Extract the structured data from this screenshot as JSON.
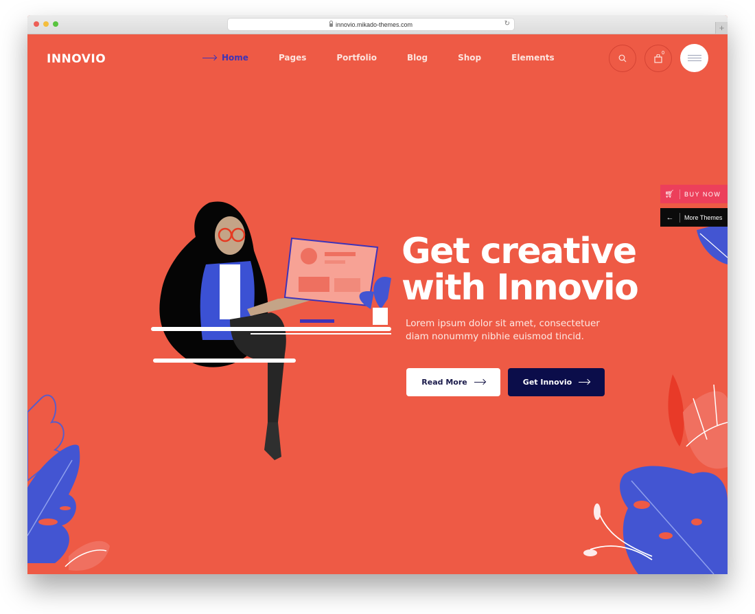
{
  "browser": {
    "url": "innovio.mikado-themes.com",
    "new_tab_label": "+"
  },
  "header": {
    "logo": "INNOVIO",
    "nav": [
      {
        "label": "Home",
        "active": true
      },
      {
        "label": "Pages",
        "active": false
      },
      {
        "label": "Portfolio",
        "active": false
      },
      {
        "label": "Blog",
        "active": false
      },
      {
        "label": "Shop",
        "active": false
      },
      {
        "label": "Elements",
        "active": false
      }
    ],
    "cart_count": "0"
  },
  "side_widgets": {
    "buy_now": "BUY NOW",
    "more_themes": "More Themes"
  },
  "hero": {
    "title_line1": "Get creative",
    "title_line2": "with Innovio",
    "subtitle_line1": "Lorem ipsum dolor sit amet, consectetuer",
    "subtitle_line2": "diam nonummy nibhie euismod tincid.",
    "read_more": "Read More",
    "get_innovio": "Get Innovio"
  },
  "colors": {
    "background": "#ee5a45",
    "accent_blue": "#3d33b8",
    "button_dark": "#0b0d4a",
    "buy_now": "#ec3f5b",
    "leaf_blue": "#4355d2"
  }
}
